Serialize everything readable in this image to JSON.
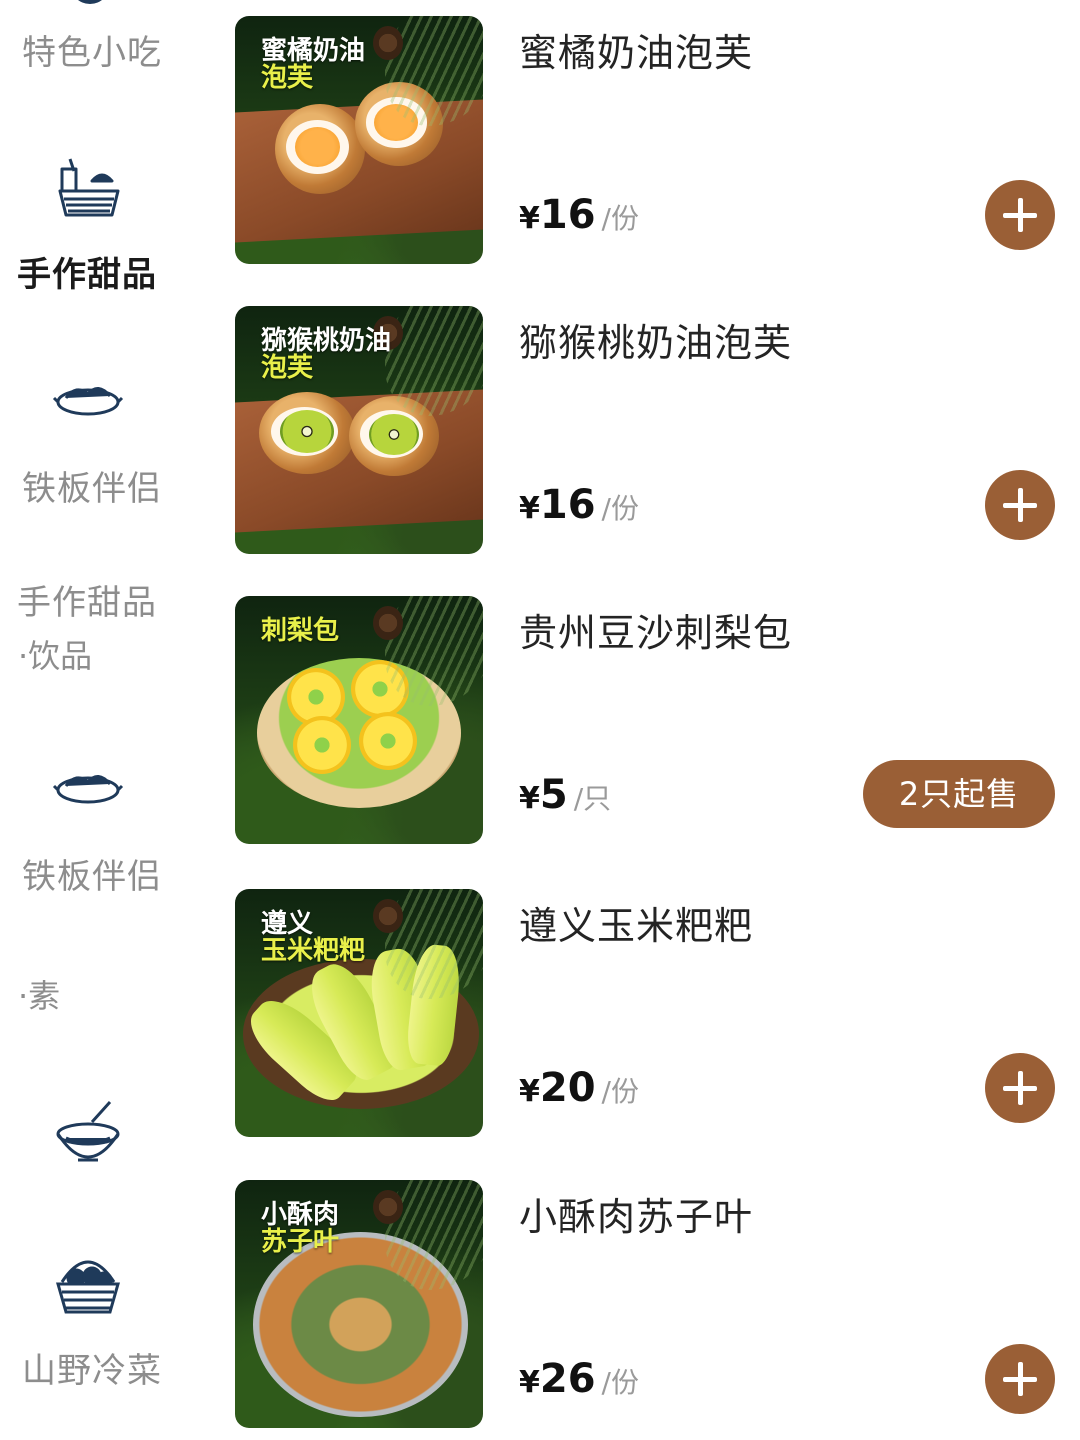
{
  "sidebar": {
    "categories": [
      {
        "label": "特色小吃",
        "active": false,
        "icon": "top-partial-icon"
      },
      {
        "label": "手作甜品",
        "active": true,
        "icon": "dessert-drink-basket-icon"
      },
      {
        "label": "铁板伴侣",
        "active": false,
        "icon": "griddle-dish-icon"
      },
      {
        "label": "手作甜品",
        "sub": "·饮品",
        "active": false
      },
      {
        "label": "铁板伴侣",
        "sub": "·素",
        "active": false,
        "icon": "griddle-dish-icon"
      },
      {
        "label": "山野冷菜",
        "active": false,
        "icon": "fruit-basket-icon"
      }
    ],
    "soup_icon": "soup-bowl-icon"
  },
  "products": [
    {
      "name": "蜜橘奶油泡芙",
      "caption_top": "蜜橘奶油",
      "caption_hl": "泡芙",
      "currency": "¥",
      "price": "16",
      "unit": "/份",
      "action": "add"
    },
    {
      "name": "猕猴桃奶油泡芙",
      "caption_top": "猕猴桃奶油",
      "caption_hl": "泡芙",
      "currency": "¥",
      "price": "16",
      "unit": "/份",
      "action": "add"
    },
    {
      "name": "贵州豆沙刺梨包",
      "caption_top": "",
      "caption_hl": "刺梨包",
      "currency": "¥",
      "price": "5",
      "unit": "/只",
      "action": "min",
      "min_label": "2只起售"
    },
    {
      "name": "遵义玉米粑粑",
      "caption_top": "遵义",
      "caption_hl": "玉米粑粑",
      "currency": "¥",
      "price": "20",
      "unit": "/份",
      "action": "add"
    },
    {
      "name": "小酥肉苏子叶",
      "caption_top": "小酥肉",
      "caption_hl": "苏子叶",
      "currency": "¥",
      "price": "26",
      "unit": "/份",
      "action": "add"
    }
  ],
  "colors": {
    "accent": "#9a5f36",
    "icon": "#1f3a5a",
    "inactive_text": "#8d8d8d"
  }
}
